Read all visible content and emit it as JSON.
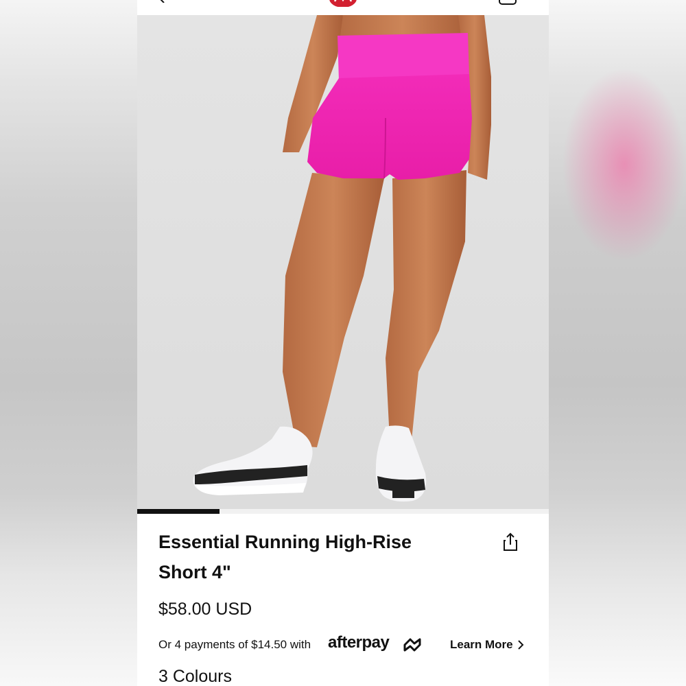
{
  "product": {
    "title_line1": "Essential Running High-Rise",
    "title_line2": "Short 4\"",
    "price": "$58.00 USD",
    "installments_text": "Or 4 payments of $14.50 with",
    "payment_brand": "afterpay",
    "learn_more_label": "Learn More",
    "colours_label": "3 Colours"
  },
  "gallery": {
    "progress_fraction": 0.2
  },
  "icons": {
    "back": "chevron-left-icon",
    "logo": "brand-logo",
    "bag": "shopping-bag-icon",
    "share": "share-icon",
    "learn_more": "chevron-right-icon"
  },
  "colors": {
    "accent": "#e0218a",
    "logo_red": "#d22030",
    "text": "#111111"
  }
}
